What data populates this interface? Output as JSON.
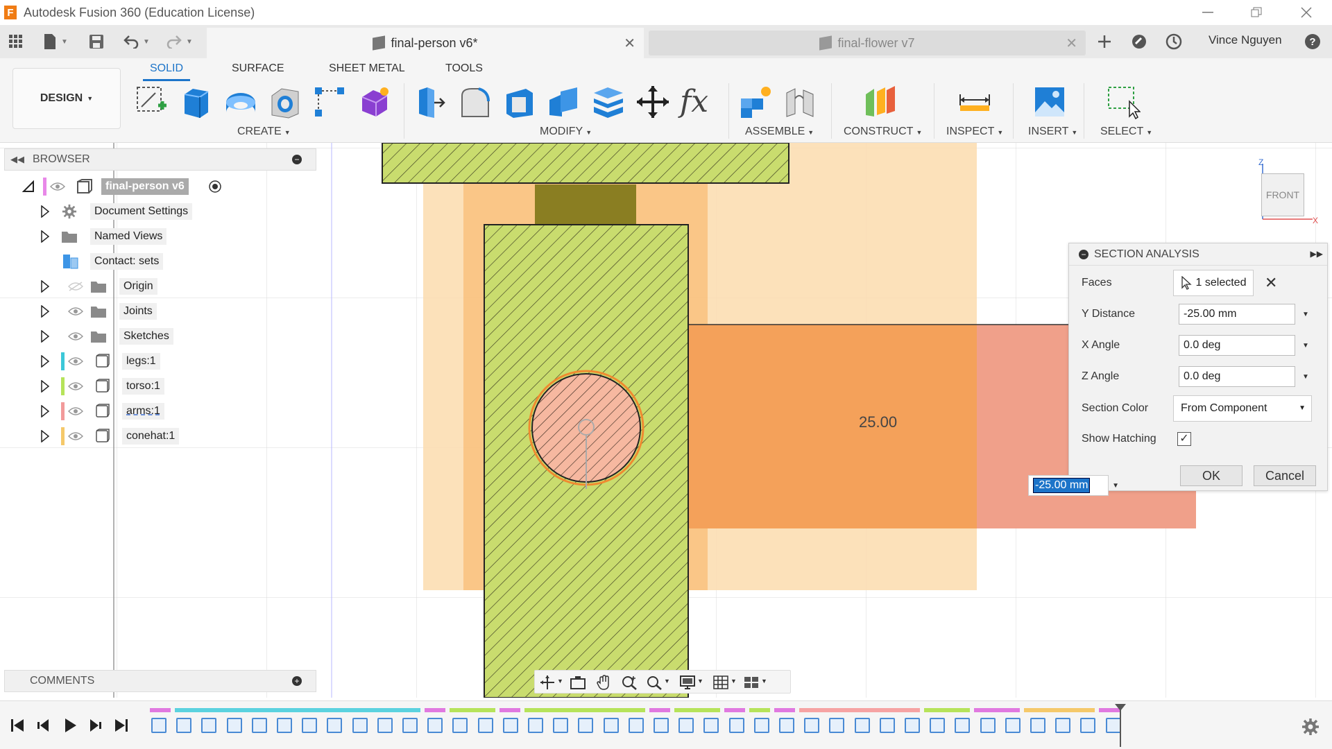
{
  "window": {
    "title": "Autodesk Fusion 360 (Education License)",
    "logo": "F"
  },
  "tabs": {
    "active": {
      "label": "final-person v6*"
    },
    "inactive": {
      "label": "final-flower v7"
    }
  },
  "user": {
    "name": "Vince Nguyen"
  },
  "toolbar": {
    "workspace": "DESIGN",
    "workspace_tabs": [
      "SOLID",
      "SURFACE",
      "SHEET METAL",
      "TOOLS"
    ],
    "groups": [
      "CREATE",
      "MODIFY",
      "ASSEMBLE",
      "CONSTRUCT",
      "INSPECT",
      "INSERT",
      "SELECT"
    ],
    "fx_label": "fx"
  },
  "browser": {
    "title": "BROWSER",
    "root": "final-person v6",
    "items": [
      {
        "label": "Document Settings",
        "icon": "gear-icon"
      },
      {
        "label": "Named Views",
        "icon": "folder-icon"
      },
      {
        "label": "Contact: sets",
        "icon": "contact-set-icon"
      },
      {
        "label": "Origin",
        "icon": "folder-icon"
      },
      {
        "label": "Joints",
        "icon": "folder-icon"
      },
      {
        "label": "Sketches",
        "icon": "folder-icon"
      },
      {
        "label": "legs:1",
        "icon": "component-icon",
        "color": "#3cc8d8"
      },
      {
        "label": "torso:1",
        "icon": "component-icon",
        "color": "#b6e35a"
      },
      {
        "label": "arms:1",
        "icon": "component-icon",
        "color": "#f29a9a"
      },
      {
        "label": "conehat:1",
        "icon": "component-icon",
        "color": "#f5c96a"
      }
    ]
  },
  "comments": {
    "title": "COMMENTS"
  },
  "viewport": {
    "section_dimension": "25.00",
    "viewcube_label": "FRONT",
    "axis_z": "Z",
    "axis_x": "X"
  },
  "section_analysis": {
    "title": "SECTION ANALYSIS",
    "faces_label": "Faces",
    "faces_value": "1 selected",
    "y_distance_label": "Y Distance",
    "y_distance_value": "-25.00 mm",
    "x_angle_label": "X Angle",
    "x_angle_value": "0.0 deg",
    "z_angle_label": "Z Angle",
    "z_angle_value": "0.0 deg",
    "section_color_label": "Section Color",
    "section_color_value": "From Component",
    "show_hatching_label": "Show Hatching",
    "show_hatching_checked": true,
    "ok_label": "OK",
    "cancel_label": "Cancel"
  },
  "floating_input": {
    "value": "-25.00 mm"
  },
  "colors": {
    "accent": "#1c74c9",
    "hatch_green": "#c9dc6e",
    "orange_body": "#f5a25b",
    "light_orange": "#fbd7a4",
    "salmon": "#f0a08a",
    "olive": "#8a7e22"
  }
}
